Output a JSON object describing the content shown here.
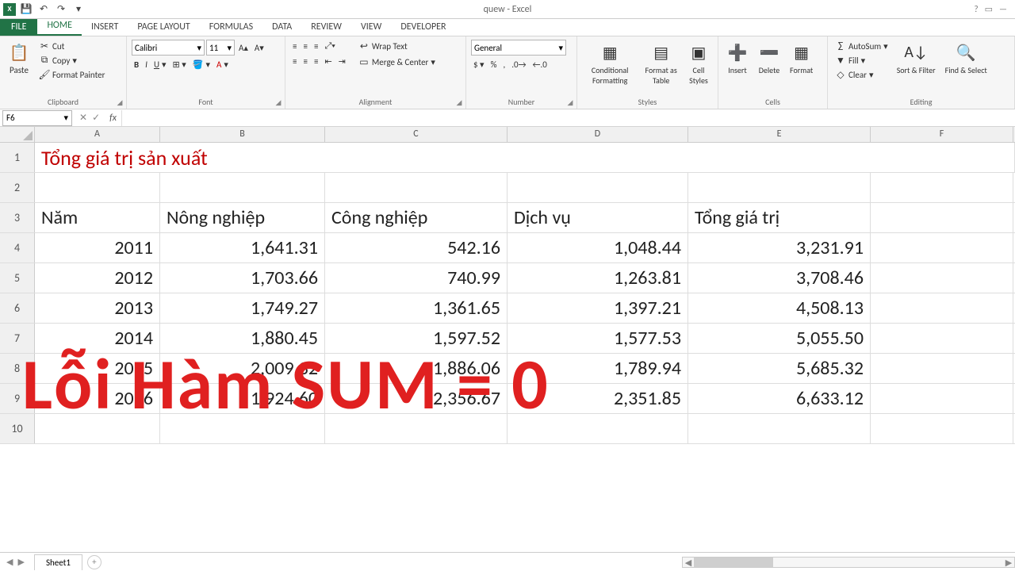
{
  "title": "quew - Excel",
  "tabs": {
    "file": "FILE",
    "items": [
      "HOME",
      "INSERT",
      "PAGE LAYOUT",
      "FORMULAS",
      "DATA",
      "REVIEW",
      "VIEW",
      "DEVELOPER"
    ],
    "active": "HOME"
  },
  "ribbon": {
    "clipboard": {
      "label": "Clipboard",
      "paste": "Paste",
      "cut": "Cut",
      "copy": "Copy",
      "painter": "Format Painter"
    },
    "font": {
      "label": "Font",
      "name": "Calibri",
      "size": "11"
    },
    "alignment": {
      "label": "Alignment",
      "wrap": "Wrap Text",
      "merge": "Merge & Center"
    },
    "number": {
      "label": "Number",
      "format": "General"
    },
    "styles": {
      "label": "Styles",
      "cond": "Conditional Formatting",
      "table": "Format as Table",
      "cell": "Cell Styles"
    },
    "cells": {
      "label": "Cells",
      "insert": "Insert",
      "delete": "Delete",
      "format": "Format"
    },
    "editing": {
      "label": "Editing",
      "autosum": "AutoSum",
      "fill": "Fill",
      "clear": "Clear",
      "sort": "Sort & Filter",
      "find": "Find & Select"
    }
  },
  "namebox": "F6",
  "columns": [
    "A",
    "B",
    "C",
    "D",
    "E",
    "F"
  ],
  "sheet": {
    "title_cell": "Tổng giá trị sản xuất",
    "headers": [
      "Năm",
      "Nông nghiệp",
      "Công nghiệp",
      "Dịch vụ",
      "Tổng giá trị"
    ],
    "rows": [
      {
        "A": "2011",
        "B": "1,641.31",
        "C": "542.16",
        "D": "1,048.44",
        "E": "3,231.91"
      },
      {
        "A": "2012",
        "B": "1,703.66",
        "C": "740.99",
        "D": "1,263.81",
        "E": "3,708.46"
      },
      {
        "A": "2013",
        "B": "1,749.27",
        "C": "1,361.65",
        "D": "1,397.21",
        "E": "4,508.13"
      },
      {
        "A": "2014",
        "B": "1,880.45",
        "C": "1,597.52",
        "D": "1,577.53",
        "E": "5,055.50"
      },
      {
        "A": "2015",
        "B": "2,009.32",
        "C": "1,886.06",
        "D": "1,789.94",
        "E": "5,685.32"
      },
      {
        "A": "2016",
        "B": "1,924.60",
        "C": "2,356.67",
        "D": "2,351.85",
        "E": "6,633.12"
      }
    ]
  },
  "overlay_text": "Lỗi Hàm SUM = 0",
  "sheet_tab": "Sheet1"
}
